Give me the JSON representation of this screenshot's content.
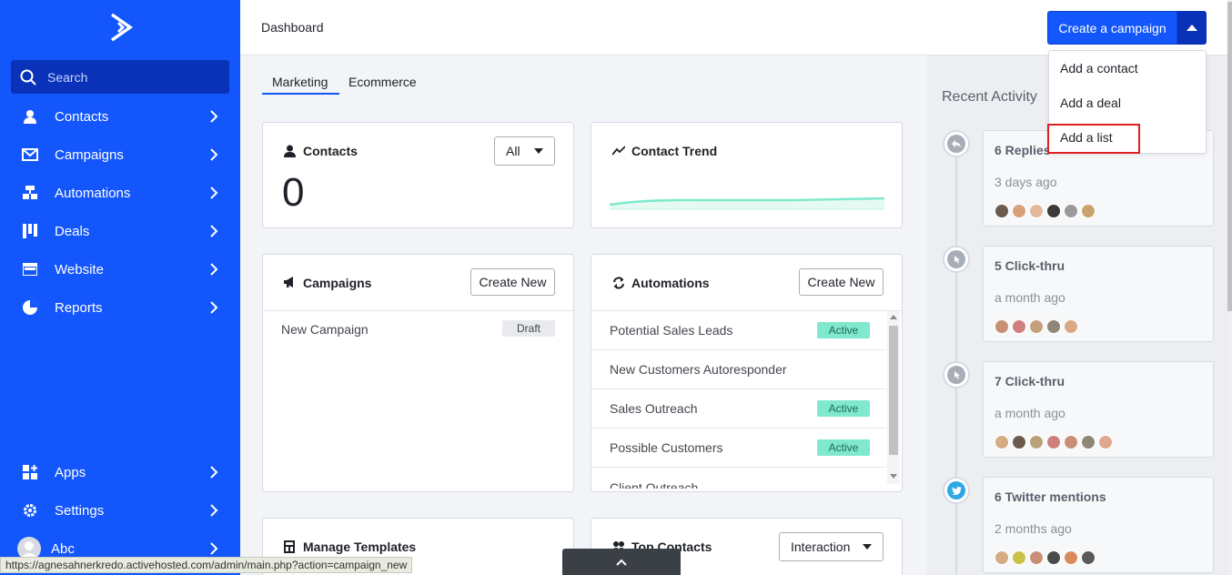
{
  "sidebar": {
    "search_placeholder": "Search",
    "items": [
      {
        "label": "Contacts",
        "icon": "person-icon"
      },
      {
        "label": "Campaigns",
        "icon": "envelope-icon"
      },
      {
        "label": "Automations",
        "icon": "flow-icon"
      },
      {
        "label": "Deals",
        "icon": "pipeline-icon"
      },
      {
        "label": "Website",
        "icon": "browser-icon"
      },
      {
        "label": "Reports",
        "icon": "pie-chart-icon"
      }
    ],
    "bottom_items": [
      {
        "label": "Apps",
        "icon": "apps-grid-icon"
      },
      {
        "label": "Settings",
        "icon": "gear-icon"
      },
      {
        "label": "Abc",
        "icon": "avatar-icon"
      }
    ]
  },
  "header": {
    "title": "Dashboard",
    "create_label": "Create a campaign"
  },
  "dropdown": {
    "items": [
      "Add a contact",
      "Add a deal",
      "Add a list"
    ]
  },
  "tabs": [
    "Marketing",
    "Ecommerce"
  ],
  "contacts_card": {
    "title": "Contacts",
    "filter": "All",
    "count": "0"
  },
  "trend_card": {
    "title": "Contact Trend"
  },
  "campaigns_card": {
    "title": "Campaigns",
    "button": "Create New",
    "rows": [
      {
        "name": "New Campaign",
        "status": "Draft"
      }
    ]
  },
  "automations_card": {
    "title": "Automations",
    "button": "Create New",
    "rows": [
      {
        "name": "Potential Sales Leads",
        "status": "Active"
      },
      {
        "name": "New Customers Autoresponder",
        "status": ""
      },
      {
        "name": "Sales Outreach",
        "status": "Active"
      },
      {
        "name": "Possible Customers",
        "status": "Active"
      },
      {
        "name": "Client Outreach",
        "status": ""
      }
    ]
  },
  "templates_card": {
    "title": "Manage Templates"
  },
  "top_contacts_card": {
    "title": "Top Contacts",
    "filter": "Interaction"
  },
  "recent_activity": {
    "title": "Recent Activity",
    "items": [
      {
        "title": "6 Replies",
        "time": "3 days ago",
        "icon": "reply-icon",
        "avatars": 6
      },
      {
        "title": "5 Click-thru",
        "time": "a month ago",
        "icon": "click-icon",
        "avatars": 5
      },
      {
        "title": "7 Click-thru",
        "time": "a month ago",
        "icon": "click-icon",
        "avatars": 7
      },
      {
        "title": "6 Twitter mentions",
        "time": "2 months ago",
        "icon": "twitter-icon",
        "avatars": 6
      }
    ]
  },
  "status_bar": {
    "url": "https://agnesahnerkredo.activehosted.com/admin/main.php?action=campaign_new"
  },
  "colors": {
    "brand": "#1356fb",
    "active_badge": "#80e8cc",
    "highlight": "#e02020"
  }
}
